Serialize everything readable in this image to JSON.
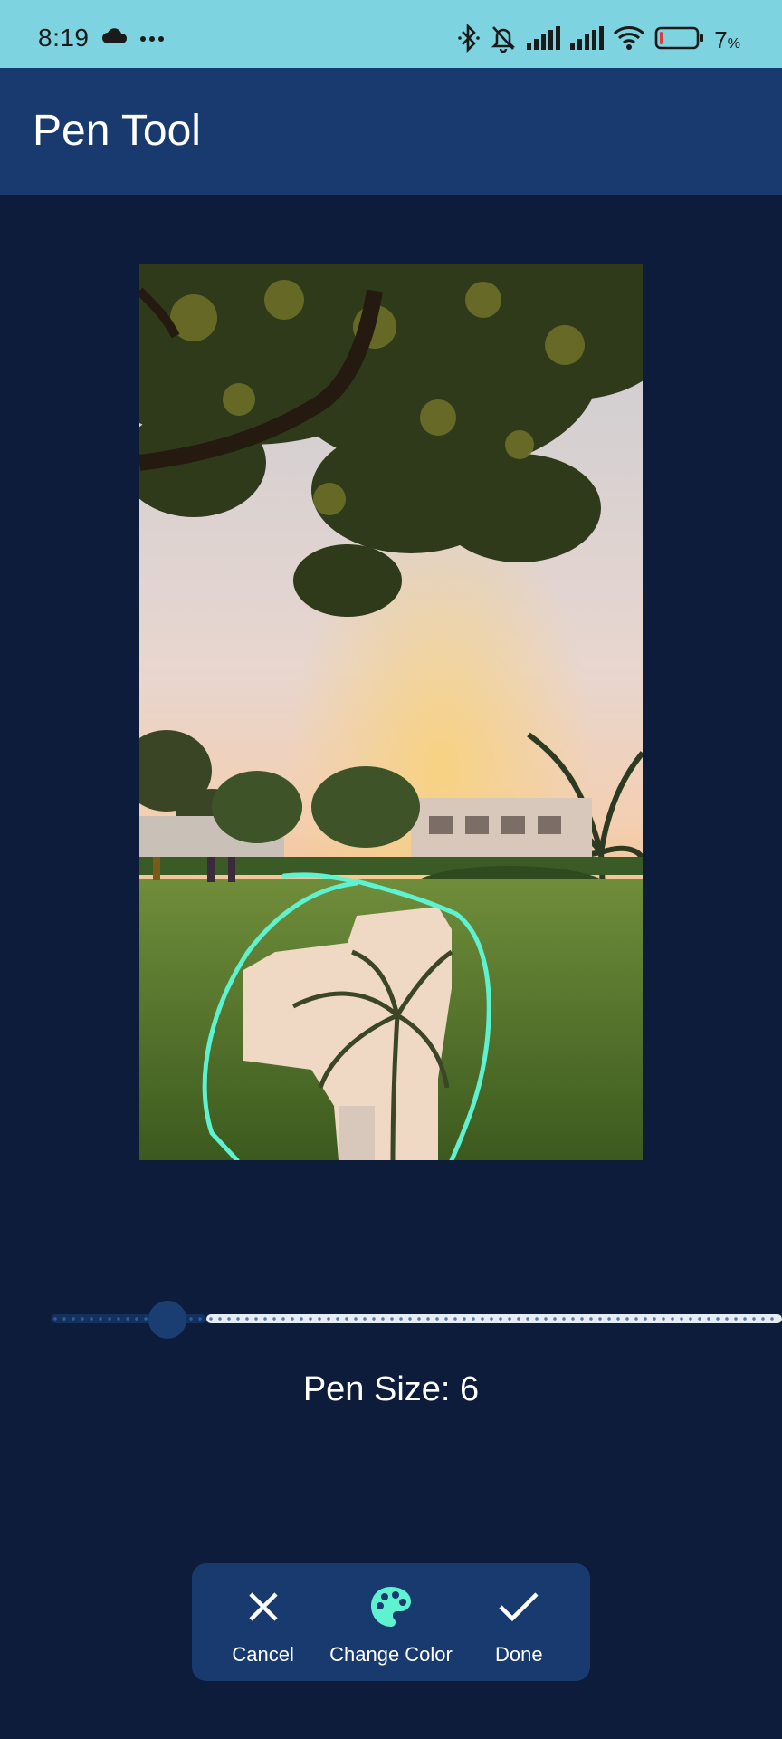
{
  "status_bar": {
    "time": "8:19",
    "battery_percent": "7",
    "battery_unit": "%",
    "battery_level": 0.07,
    "icons": [
      "cloud-icon",
      "more-dots-icon",
      "bluetooth-icon",
      "bell-off-icon",
      "signal-icon",
      "signal-icon",
      "wifi-icon",
      "battery-icon"
    ]
  },
  "app_bar": {
    "title": "Pen Tool"
  },
  "pen": {
    "stroke_color": "#5ef2d0",
    "size_label": "Pen Size: 6",
    "slider_fraction": 0.16
  },
  "toolbar": {
    "cancel_label": "Cancel",
    "change_color_label": "Change Color",
    "done_label": "Done",
    "icons": [
      "close-icon",
      "palette-icon",
      "check-icon"
    ]
  },
  "colors": {
    "background": "#0c1c3a",
    "app_bar": "#183a6e",
    "status_bar": "#7dd3e0",
    "accent": "#5ef2d0"
  }
}
